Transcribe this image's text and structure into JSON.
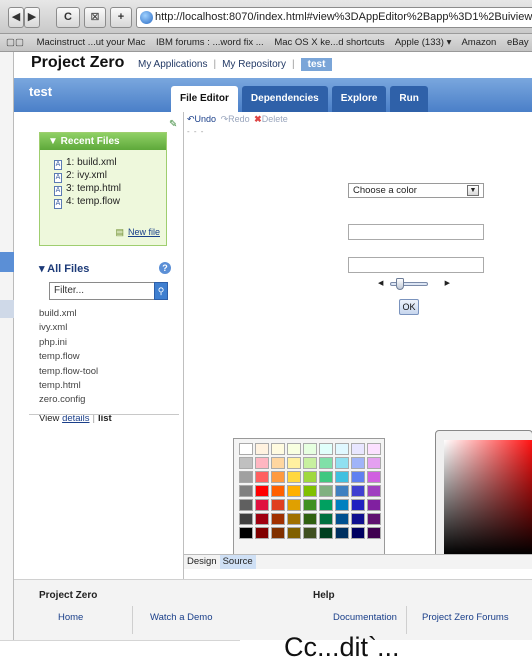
{
  "browser": {
    "nav_back": "◀",
    "nav_forward": "▶",
    "reload": "C",
    "add_tab": "+",
    "url": "http://localhost:8070/index.html#view%3DAppEditor%2Bapp%3D1%2Buiview%3DallFilesView",
    "bookmarks": [
      "Macinstruct ...ut your Mac",
      "IBM forums : ...word fix ...",
      "Mac OS X ke...d shortcuts",
      "Apple (133) ▾",
      "Amazon",
      "eBay",
      "Y"
    ]
  },
  "header": {
    "title": "Project Zero",
    "nav": [
      "My Applications",
      "My Repository",
      "test"
    ]
  },
  "app": {
    "name": "test",
    "tabs": [
      "File Editor",
      "Dependencies",
      "Explore",
      "Run"
    ]
  },
  "sidebar": {
    "recent_title": "▼ Recent Files",
    "recent_files": [
      "1: build.xml",
      "2: ivy.xml",
      "3: temp.html",
      "4: temp.flow"
    ],
    "new_file": "New file",
    "all_files_title": "▾ All Files",
    "help": "?",
    "filter_placeholder": "Filter...",
    "files": [
      "build.xml",
      "ivy.xml",
      "php.ini",
      "temp.flow",
      "temp.flow-tool",
      "temp.html",
      "zero.config"
    ],
    "view_label": "View",
    "view_details": "details",
    "view_list": "list"
  },
  "editor": {
    "undo": "Undo",
    "redo": "Redo",
    "delete": "Delete",
    "dots": "- - -",
    "select_value": "Choose a color",
    "ok_button": "OK",
    "bottom_tabs": [
      "Design",
      "Source"
    ]
  },
  "swatch_colors": [
    [
      "#ffffff",
      "#fff2e0",
      "#fffbe0",
      "#f8ffe0",
      "#e6ffe0",
      "#e0fffb",
      "#e0f8ff",
      "#e8e6ff",
      "#fce0ff"
    ],
    [
      "#c0c0c0",
      "#ffb6c1",
      "#ffd6a0",
      "#fff0a0",
      "#c8f0a0",
      "#80e0a8",
      "#90e0f0",
      "#a0b4f8",
      "#e4a0f0"
    ],
    [
      "#a0a0a0",
      "#ff6060",
      "#ff9a40",
      "#ffd840",
      "#a0d840",
      "#40c880",
      "#40c0e0",
      "#6080f0",
      "#d060e0"
    ],
    [
      "#808080",
      "#ff0000",
      "#ff6000",
      "#ffb000",
      "#80c000",
      "#80b080",
      "#4080c0",
      "#4040d0",
      "#a040c0"
    ],
    [
      "#606060",
      "#e01040",
      "#e04020",
      "#e0a000",
      "#409020",
      "#00a060",
      "#0080c0",
      "#2020c0",
      "#8020a0"
    ],
    [
      "#404040",
      "#a00010",
      "#a03000",
      "#a07000",
      "#306010",
      "#007040",
      "#005090",
      "#101090",
      "#601070"
    ],
    [
      "#000000",
      "#800000",
      "#803000",
      "#806000",
      "#405020",
      "#004020",
      "#003060",
      "#000060",
      "#400050"
    ]
  ],
  "footer": {
    "col1_title": "Project Zero",
    "col1_links": [
      "Home",
      "Watch a Demo"
    ],
    "col2_title": "Help",
    "col2_links": [
      "Documentation",
      "Project Zero Forums"
    ]
  },
  "overlay_text": "Cc...dit`..."
}
